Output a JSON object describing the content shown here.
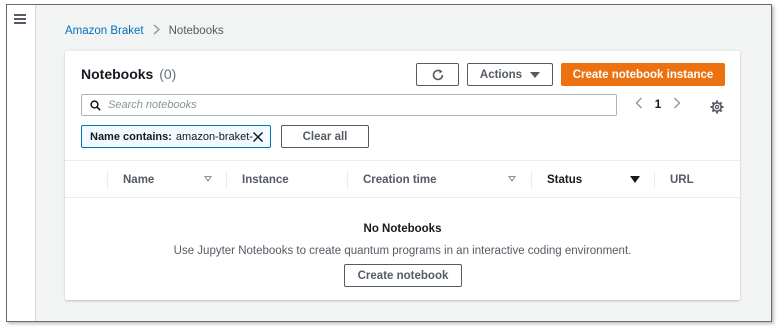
{
  "breadcrumb": {
    "root": "Amazon Braket",
    "separator": ">",
    "current": "Notebooks"
  },
  "panel": {
    "title": "Notebooks",
    "count": "(0)"
  },
  "toolbar": {
    "actions_label": "Actions",
    "create_instance_label": "Create notebook instance"
  },
  "search": {
    "placeholder": "Search notebooks"
  },
  "pagination": {
    "prev": "<",
    "page": "1",
    "next": ">"
  },
  "filter": {
    "key": "Name contains:",
    "value": "amazon-braket-",
    "clear_all_label": "Clear all"
  },
  "table": {
    "columns": [
      {
        "label": "Name",
        "sortable": true
      },
      {
        "label": "Instance",
        "sortable": false
      },
      {
        "label": "Creation time",
        "sortable": true
      },
      {
        "label": "Status",
        "sortable": true,
        "active": true
      },
      {
        "label": "URL",
        "sortable": false
      }
    ]
  },
  "empty_state": {
    "title": "No Notebooks",
    "description": "Use Jupyter Notebooks to create quantum programs in an interactive coding environment.",
    "button_label": "Create notebook"
  },
  "colors": {
    "primary": "#ec7211",
    "link": "#0073bb",
    "filter_border": "#0073bb",
    "background": "#f2f3f3"
  },
  "icons": [
    "menu-icon",
    "refresh-icon",
    "caret-down-icon",
    "search-icon",
    "settings-icon",
    "close-icon",
    "sort-icon"
  ]
}
